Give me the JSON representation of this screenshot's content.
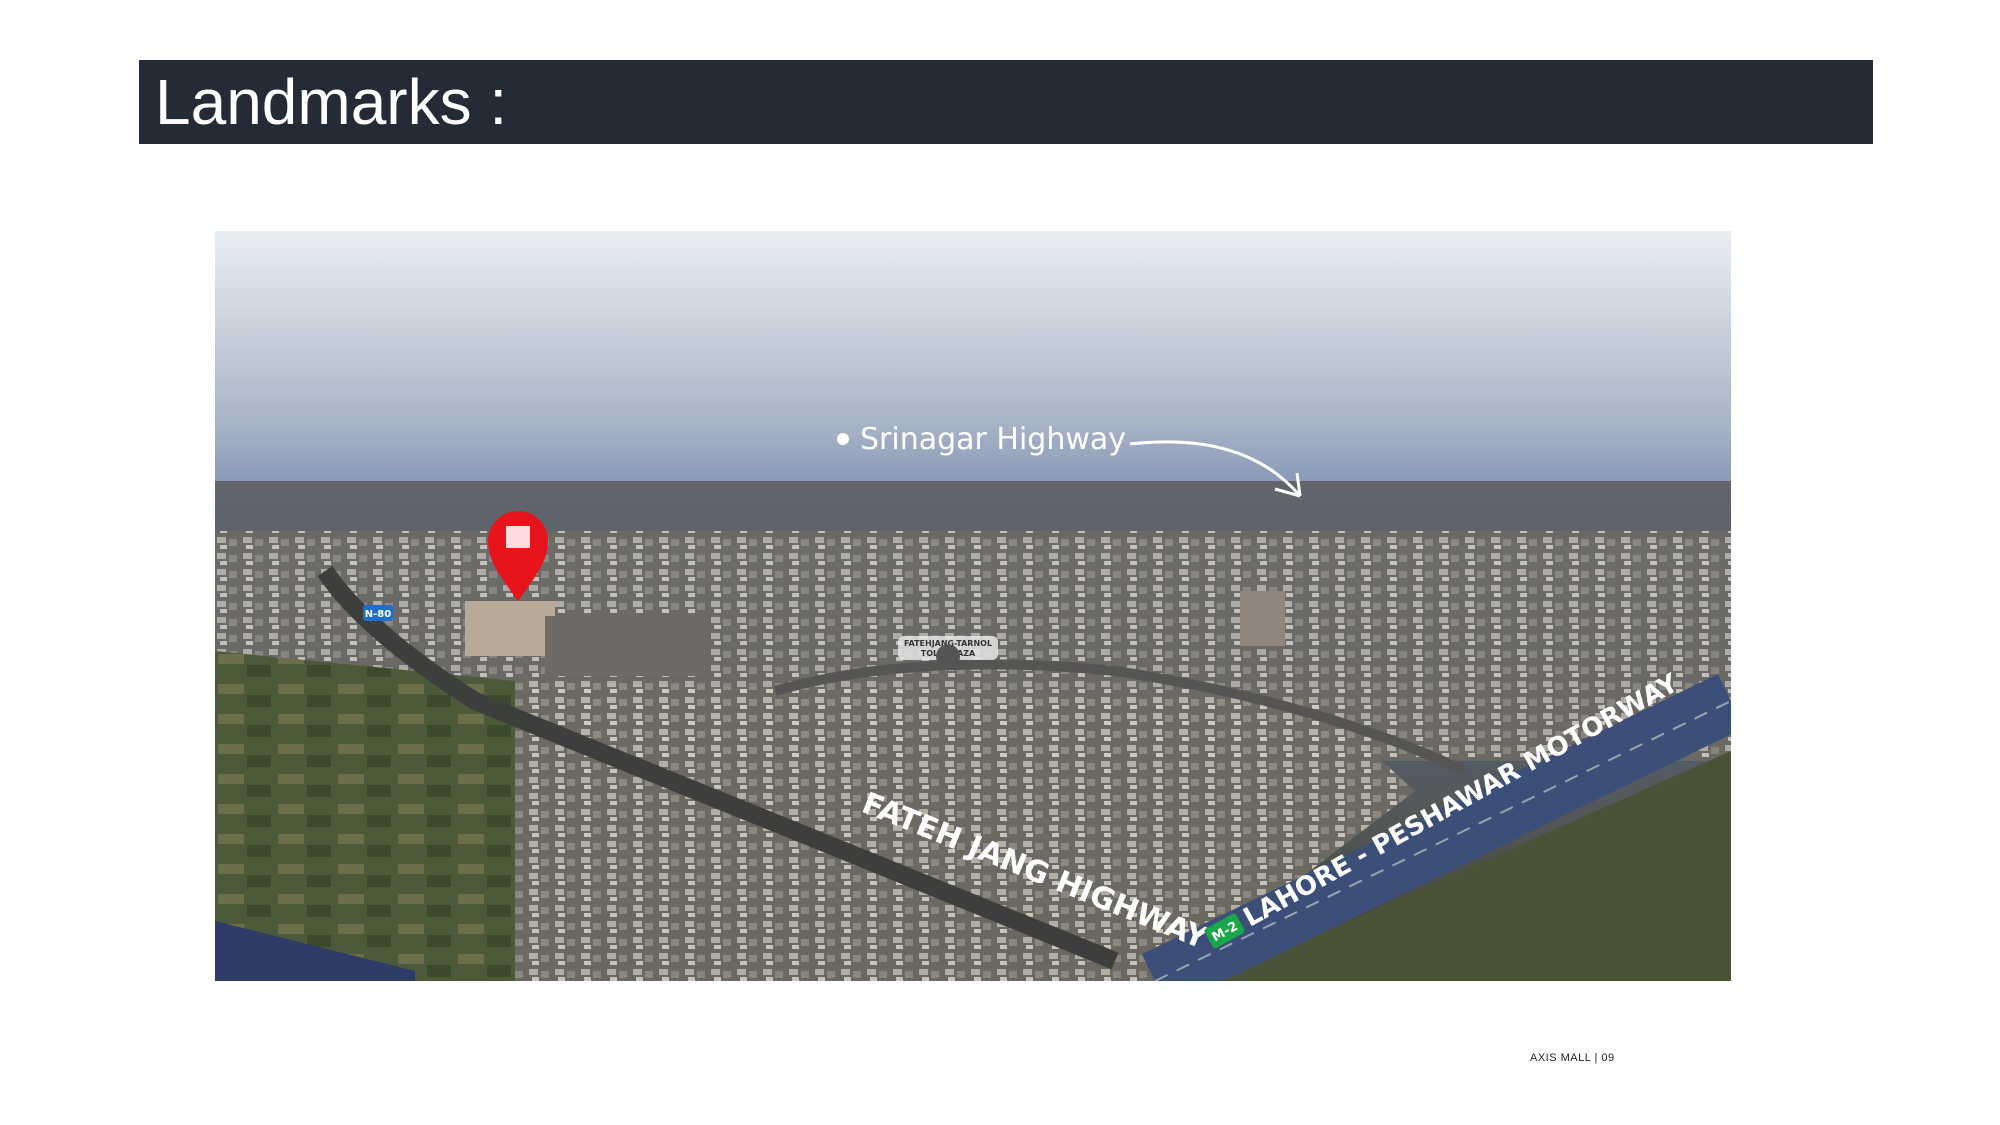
{
  "title": "Landmarks :",
  "photo": {
    "labels": {
      "srinagar": "Srinagar Highway",
      "toll_plaza_line1": "FATEHJANG-TARNOL",
      "toll_plaza_line2": "TOLL PLAZA",
      "n80_badge": "N-80",
      "fateh_jang": "FATEH JANG HIGHWAY",
      "m2_badge": "M-2",
      "motorway": "LAHORE - PESHAWAR MOTORWAY"
    },
    "colors": {
      "pin": "#e8141c",
      "n80_badge": "#1f6fc8",
      "m2_badge": "#1aa64a"
    }
  },
  "footer": "AXIS MALL | 09"
}
